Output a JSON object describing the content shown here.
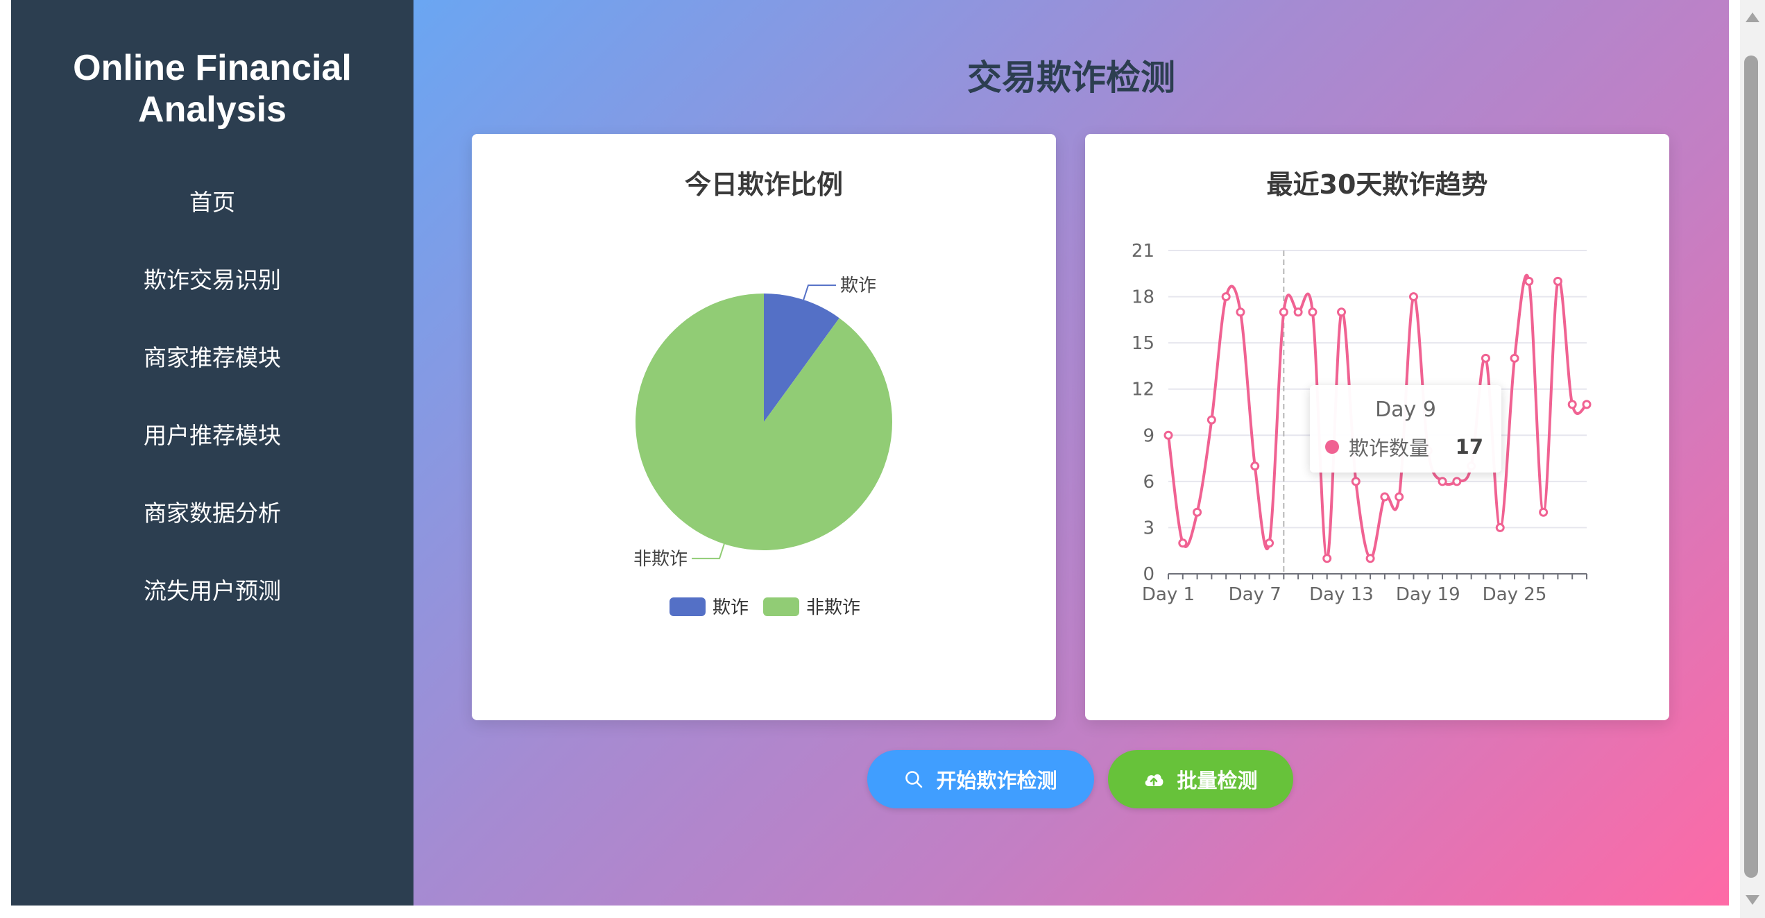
{
  "sidebar": {
    "brand_line1": "Online Financial",
    "brand_line2": "Analysis",
    "items": [
      {
        "label": "首页"
      },
      {
        "label": "欺诈交易识别"
      },
      {
        "label": "商家推荐模块"
      },
      {
        "label": "用户推荐模块"
      },
      {
        "label": "商家数据分析"
      },
      {
        "label": "流失用户预测"
      }
    ]
  },
  "main": {
    "title": "交易欺诈检测",
    "buttons": {
      "detect_label": "开始欺诈检测",
      "batch_label": "批量检测"
    }
  },
  "colors": {
    "sidebar_bg": "#2c3e50",
    "fraud": "#5470c6",
    "non_fraud": "#91cc75",
    "trend_line": "#f06292",
    "detect_button": "#409eff",
    "batch_button": "#67c23a"
  },
  "icons": {
    "detect_button": "search-icon",
    "batch_button": "cloud-upload-icon"
  },
  "chart_data": [
    {
      "type": "pie",
      "title": "今日欺诈比例",
      "labels": [
        "欺诈",
        "非欺诈"
      ],
      "values": [
        10,
        90
      ],
      "legend": "bottom-center"
    },
    {
      "type": "line",
      "title": "最近30天欺诈趋势",
      "x": [
        "Day 1",
        "Day 2",
        "Day 3",
        "Day 4",
        "Day 5",
        "Day 6",
        "Day 7",
        "Day 8",
        "Day 9",
        "Day 10",
        "Day 11",
        "Day 12",
        "Day 13",
        "Day 14",
        "Day 15",
        "Day 16",
        "Day 17",
        "Day 18",
        "Day 19",
        "Day 20",
        "Day 21",
        "Day 22",
        "Day 23",
        "Day 24",
        "Day 25",
        "Day 26",
        "Day 27",
        "Day 28",
        "Day 29",
        "Day 30"
      ],
      "x_tick_labels": [
        "Day 1",
        "Day 7",
        "Day 13",
        "Day 19",
        "Day 25"
      ],
      "series": [
        {
          "name": "欺诈数量",
          "values": [
            9,
            2,
            4,
            10,
            18,
            17,
            7,
            2,
            17,
            17,
            17,
            1,
            17,
            6,
            1,
            5,
            5,
            18,
            8,
            6,
            6,
            7,
            14,
            3,
            14,
            19,
            4,
            19,
            11,
            11
          ]
        }
      ],
      "y_ticks": [
        0,
        3,
        6,
        9,
        12,
        15,
        18,
        21
      ],
      "ylim": [
        0,
        21
      ],
      "grid": true,
      "smooth": true,
      "tooltip": {
        "title": "Day 9",
        "series_name": "欺诈数量",
        "value": "17"
      }
    }
  ]
}
